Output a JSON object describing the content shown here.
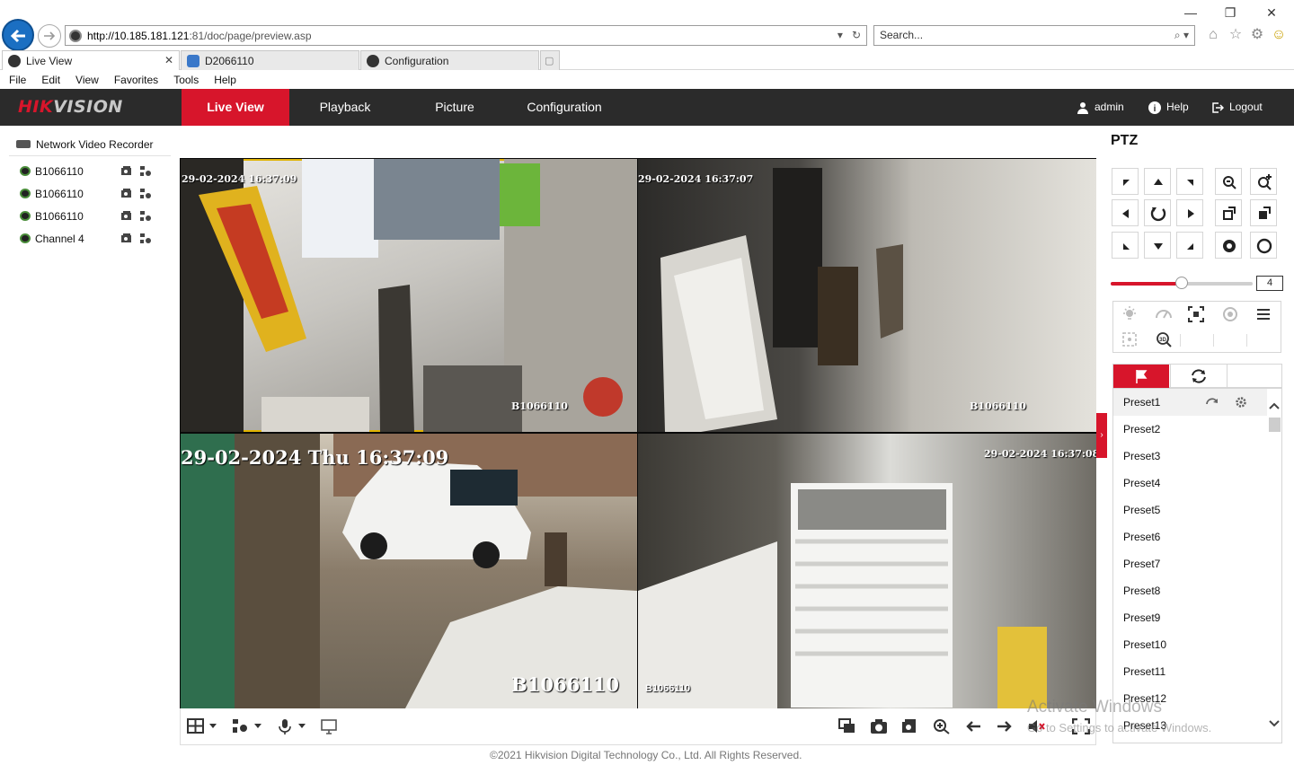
{
  "browser": {
    "url_host": "http://10.185.181.121",
    "url_rest": ":81/doc/page/preview.asp",
    "search_placeholder": "Search...",
    "tabs": [
      {
        "label": "Live View"
      },
      {
        "label": "D2066110"
      },
      {
        "label": "Configuration"
      }
    ],
    "menu": [
      "File",
      "Edit",
      "View",
      "Favorites",
      "Tools",
      "Help"
    ]
  },
  "header": {
    "logo_red": "HIK",
    "logo_grey": "VISION",
    "nav": [
      "Live View",
      "Playback",
      "Picture",
      "Configuration"
    ],
    "active_tab": "Live View",
    "user": "admin",
    "help": "Help",
    "logout": "Logout"
  },
  "tree": {
    "root": "Network Video Recorder",
    "channels": [
      "B1066110",
      "B1066110",
      "B1066110",
      "Channel 4"
    ]
  },
  "video": {
    "tiles": [
      {
        "timestamp": "29-02-2024 16:37:09",
        "name": "B1066110"
      },
      {
        "timestamp": "29-02-2024 16:37:07",
        "name": "B1066110"
      },
      {
        "timestamp": "29-02-2024 Thu 16:37:09",
        "name": "B1066110"
      },
      {
        "timestamp": "29-02-2024 16:37:08",
        "name": "B1066110"
      }
    ]
  },
  "ptz": {
    "title": "PTZ",
    "speed": "4",
    "speed_fraction": 0.5,
    "presets": [
      "Preset1",
      "Preset2",
      "Preset3",
      "Preset4",
      "Preset5",
      "Preset6",
      "Preset7",
      "Preset8",
      "Preset9",
      "Preset10",
      "Preset11",
      "Preset12",
      "Preset13"
    ]
  },
  "footer": "©2021 Hikvision Digital Technology Co., Ltd. All Rights Reserved.",
  "watermark": {
    "line1": "Activate Windows",
    "line2": "Go to Settings to activate Windows."
  },
  "colors": {
    "accent": "#d7152b",
    "header_bg": "#2b2b2b",
    "selected_tile": "#e0b300"
  }
}
